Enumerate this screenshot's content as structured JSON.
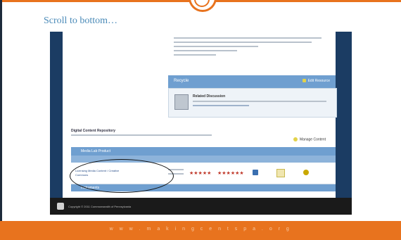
{
  "slide": {
    "heading": "Scroll to bottom…",
    "footer_url": "w w w . m a k i n g c e n t s p a . o r g"
  },
  "colors": {
    "accent_orange": "#e8731e",
    "heading_blue": "#4a8ab8",
    "screen_navy": "#1b3c63",
    "panel_blue": "#6f9fd0"
  },
  "screenshot": {
    "panel_title": "Recycle",
    "panel_action": "Edit Resource",
    "discussion_title": "Related Discussion",
    "repository_title": "Digital Content Repository",
    "manage_button": "Manage Content",
    "table_title": "Media Lab Product",
    "table_footer": "Instruments",
    "row_link": "Licensing Media Content / Creative Commons",
    "row_rating_1": "★★★★★",
    "row_rating_2": "★★★★★★",
    "footer_text": "Copyright © 2011 Commonwealth of Pennsylvania"
  },
  "annotation": {
    "shape": "oval",
    "target": "table-row-link"
  }
}
